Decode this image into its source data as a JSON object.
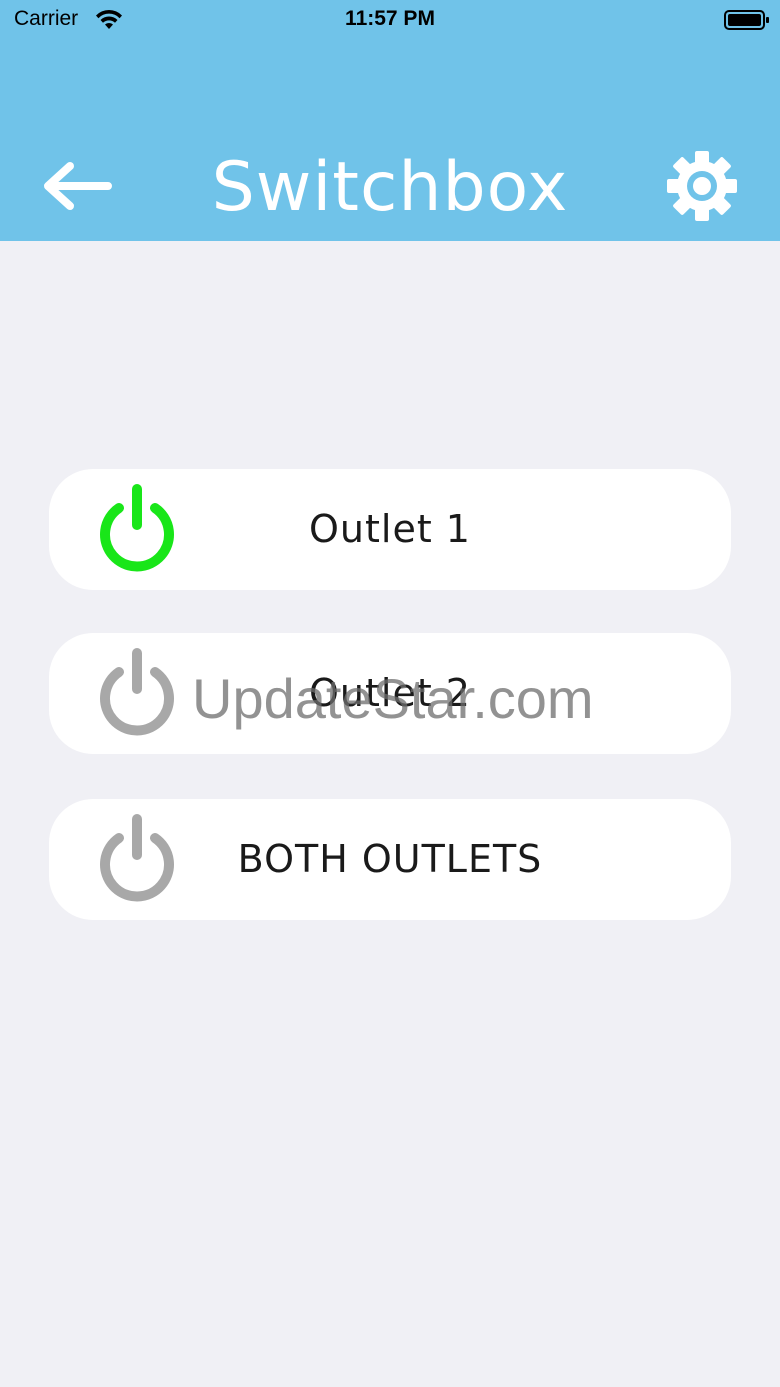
{
  "status_bar": {
    "carrier": "Carrier",
    "time": "11:57 PM",
    "wifi_icon": "wifi-icon",
    "battery_icon": "battery-full-icon"
  },
  "header": {
    "title": "Switchbox",
    "back_icon": "arrow-left-icon",
    "settings_icon": "gear-icon",
    "background_color": "#70c3e9"
  },
  "outlets": [
    {
      "label": "Outlet 1",
      "state": "on",
      "icon": "power-icon",
      "icon_color": "#19e619"
    },
    {
      "label": "Outlet 2",
      "state": "off",
      "icon": "power-icon",
      "icon_color": "#a8a8a8"
    },
    {
      "label": "BOTH OUTLETS",
      "state": "off",
      "icon": "power-icon",
      "icon_color": "#a8a8a8"
    }
  ],
  "watermark": "UpdateStar.com"
}
